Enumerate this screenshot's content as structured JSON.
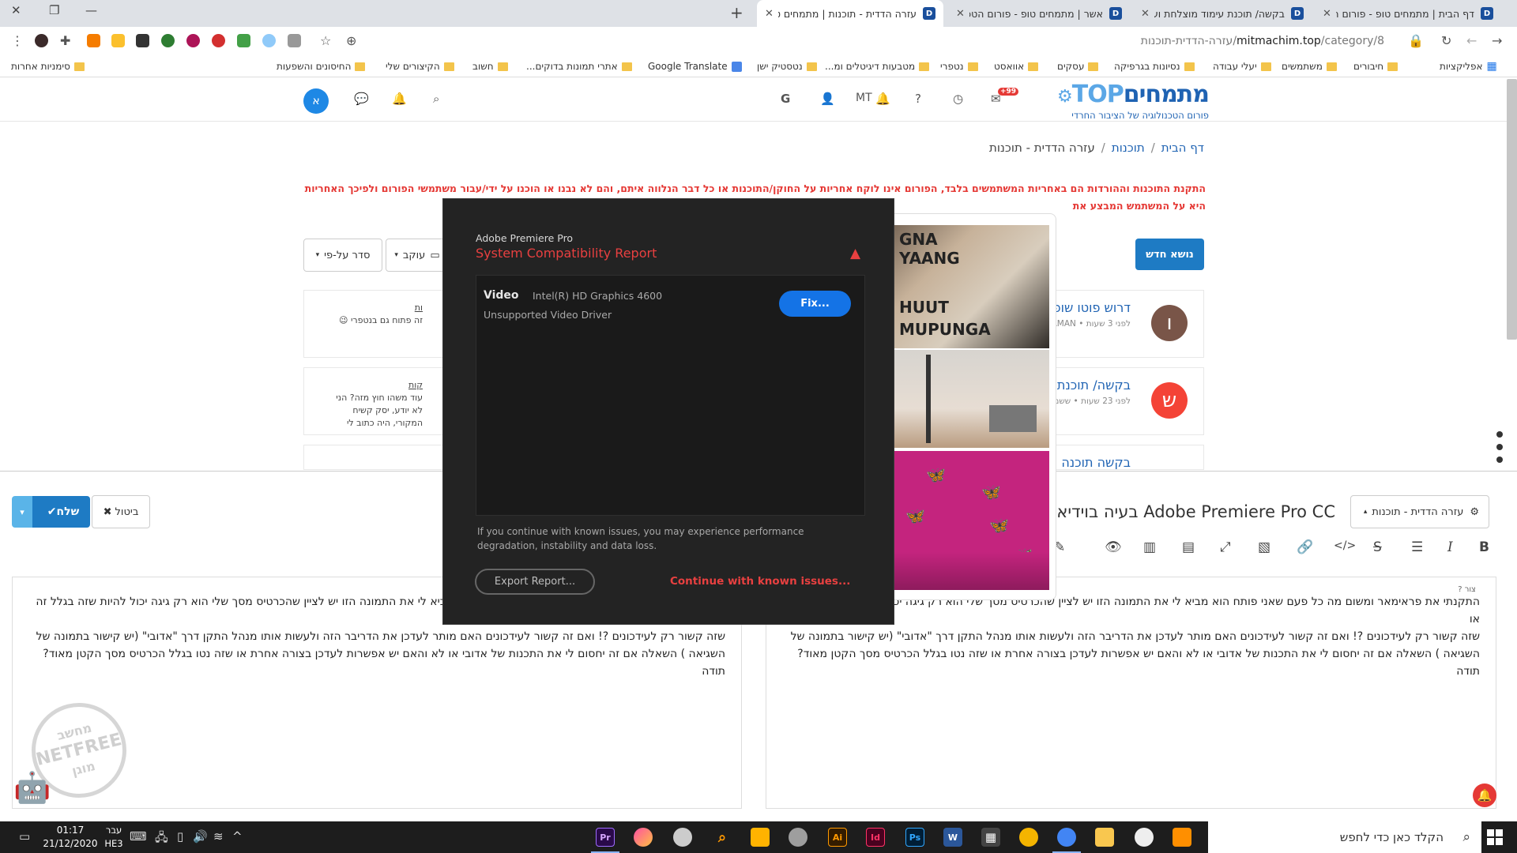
{
  "browser": {
    "tabs": [
      {
        "title": "דף הבית | מתמחים טופ - פורום ה"
      },
      {
        "title": "בקשה/ תוכנת עימוד מוצלחת ועדי"
      },
      {
        "title": "אשר | מתמחים טופ - פורום הטכ"
      },
      {
        "title": "עזרה הדדית - תוכנות | מתמחים ט"
      }
    ],
    "url_host": "mitmachim.top",
    "url_path": "/category/8/עזרה-הדדית-תוכנות",
    "bookmarks": [
      {
        "label": "אפליקציות",
        "icon": "grid"
      },
      {
        "label": "חיבורים",
        "icon": "folder"
      },
      {
        "label": "משתמשים",
        "icon": "folder"
      },
      {
        "label": "יעלי עבודה",
        "icon": "folder"
      },
      {
        "label": "נסיונות בגרפיקה",
        "icon": "folder"
      },
      {
        "label": "עסקים",
        "icon": "folder"
      },
      {
        "label": "אוואסט",
        "icon": "folder"
      },
      {
        "label": "נטפרי",
        "icon": "folder"
      },
      {
        "label": "מטבעות דיגיטלים ומ...",
        "icon": "folder"
      },
      {
        "label": "נטסטיק ישן",
        "icon": "folder"
      },
      {
        "label": "Google Translate",
        "icon": "translate"
      },
      {
        "label": "אתרי תמונות בדוקים...",
        "icon": "folder"
      },
      {
        "label": "חשוב",
        "icon": "folder"
      },
      {
        "label": "הקיצורים שלי",
        "icon": "folder"
      },
      {
        "label": "החיסונים והשפעות",
        "icon": "folder"
      },
      {
        "label": "סימניות אחרות",
        "icon": "folder"
      }
    ]
  },
  "header": {
    "brand_hebrew": "מתמחים",
    "brand_latin": "TOP",
    "tagline": "פורום הטכנולוגיה של הציבור החרדי",
    "notification_count": "+99",
    "user_initials": "MT",
    "avatar_letter": "א"
  },
  "breadcrumb": {
    "home": "דף הבית",
    "category": "תוכנות",
    "current": "עזרה הדדית - תוכנות"
  },
  "warning_text": "התקנת התוכנות וההורדות הם באחריות המשתמשים בלבד, הפורום אינו לוקח אחריות על החוקן/התוכנות או כל דבר הנלווה איתם, והם לא נבנו או הוכנו על ידי/עבור משתמשי הפורום ולפיכך האחריות היא על המשתמש המבצע את",
  "toolbar_buttons": {
    "new_topic": "נושא חדש",
    "sort": "סדר על-פי",
    "watch": "עוקב"
  },
  "topics": [
    {
      "avatar_letter": "ו",
      "avatar_color": "#795548",
      "title": "דרוש פוטו שופ",
      "meta": "לפני 3 שעות • MAMAN",
      "preview_title": "ות",
      "preview": "זה פתוח גם בנטפרי 😉"
    },
    {
      "avatar_letter": "ש",
      "avatar_color": "#f44336",
      "title": "בקשה/ תוכנת",
      "meta": "לפני 23 שעות • ששמש",
      "preview_title": "קות",
      "preview": "עוד משהו חוץ מזה? הני לא יודע, יסק קשיח המקורי, היה כתוב לי"
    },
    {
      "avatar_letter": "",
      "avatar_color": "#ffffff",
      "title": "בקשה תוכנה ל",
      "meta": "",
      "preview_title": "",
      "preview": ""
    }
  ],
  "composer": {
    "send_label": "שלח",
    "discard_label": "ביטול",
    "category_label": "עזרה הדדית - תוכנות",
    "title": "Adobe Premiere Pro CC בעיה בוידיאו",
    "editor_hint": "צור",
    "body_lines": [
      "התקנתי את פראימאר ומשום מה כל פעם שאני פותח הוא מביא לי את התמונה הזו יש לציין שהכרטיס מסך שלי הוא רק גיגה יכול להיות שזה בגלל זה או",
      "שזה קשור רק לעידכונים ?! ואם זה קשור לעידכונים האם מותר לעדכן את הדריבר הזה ולעשות אותו מנהל התקן דרך \"אדובי\" (יש קישור בתמונה של",
      "השגיאה ) השאלה אם זה יחסום לי את התכנות של אדובי או לא והאם יש אפשרות לעדכן בצורה אחרת או שזה נטו בגלל הכרטיס מסך הקטן מאוד?",
      "תודה"
    ]
  },
  "premiere_dialog": {
    "app_name": "Adobe Premiere Pro",
    "title": "System Compatibility Report",
    "category": "Video",
    "device": "Intel(R) HD Graphics 4600",
    "issue": "Unsupported Video Driver",
    "fix_label": "Fix...",
    "note": "If you continue with known issues, you may experience performance degradation, instability and data loss.",
    "export_label": "Export Report...",
    "continue_label": "Continue with known issues..."
  },
  "image_preview": {
    "sign_top": "GNA\nYAANG",
    "sign_bottom": "HUUT\nMUPUNGA"
  },
  "netfree_stamp": {
    "top": "מחשב",
    "middle": "NETFREE",
    "bottom": "מוגן"
  },
  "taskbar": {
    "time": "01:17",
    "date": "21/12/2020",
    "lang_top": "עבר",
    "lang_bottom": "HE3",
    "search_placeholder": "הקלד כאן כדי לחפש",
    "apps": [
      "Pr",
      "Ai",
      "Id",
      "Ps",
      "W"
    ]
  }
}
